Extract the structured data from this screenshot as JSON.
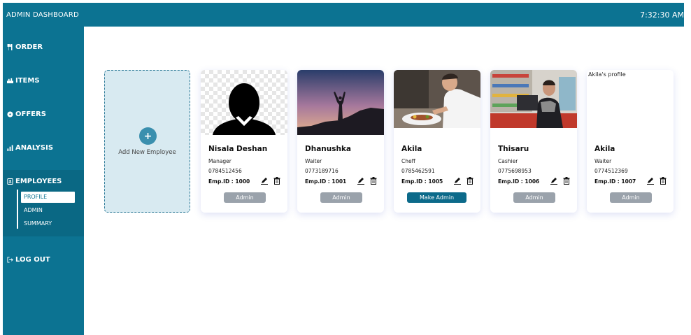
{
  "header": {
    "title": "ADMIN DASHBOARD",
    "clock": "7:32:30 AM"
  },
  "sidebar": {
    "items": [
      {
        "label": "ORDER",
        "icon": "utensils-icon"
      },
      {
        "label": "ITEMS",
        "icon": "items-icon"
      },
      {
        "label": "OFFERS",
        "icon": "offers-icon"
      },
      {
        "label": "ANALYSIS",
        "icon": "bar-chart-icon"
      },
      {
        "label": "EMPLOYEES",
        "icon": "employees-icon"
      },
      {
        "label": "LOG OUT",
        "icon": "logout-icon"
      }
    ],
    "subitems": [
      {
        "label": "PROFILE",
        "active": true
      },
      {
        "label": "ADMIN",
        "active": false
      },
      {
        "label": "SUMMARY",
        "active": false
      }
    ]
  },
  "add_card": {
    "plus": "+",
    "label": "Add New Employee"
  },
  "employees": [
    {
      "name": "Nisala Deshan",
      "role": "Manager",
      "phone": "0784512456",
      "emp_id": "Emp.ID : 1000",
      "button": "Admin",
      "photo": "placeholder-avatar",
      "caption": ""
    },
    {
      "name": "Dhanushka",
      "role": "Waiter",
      "phone": "0773189716",
      "emp_id": "Emp.ID : 1001",
      "button": "Admin",
      "photo": "sunset-silhouette",
      "caption": ""
    },
    {
      "name": "Akila",
      "role": "Cheff",
      "phone": "0785462591",
      "emp_id": "Emp.ID : 1005",
      "button": "Make Admin",
      "photo": "chef-cooking",
      "caption": ""
    },
    {
      "name": "Thisaru",
      "role": "Cashier",
      "phone": "0775698953",
      "emp_id": "Emp.ID : 1006",
      "button": "Admin",
      "photo": "cashier-shop",
      "caption": ""
    },
    {
      "name": "Akila",
      "role": "Waiter",
      "phone": "0774512369",
      "emp_id": "Emp.ID : 1007",
      "button": "Admin",
      "photo": "missing-image",
      "caption": "Akila's profile"
    }
  ],
  "colors": {
    "brand": "#0c7392",
    "accent_button": "#0c6a8a",
    "disabled_button": "#9aa2ab",
    "add_card_bg": "#d8eaf1"
  }
}
